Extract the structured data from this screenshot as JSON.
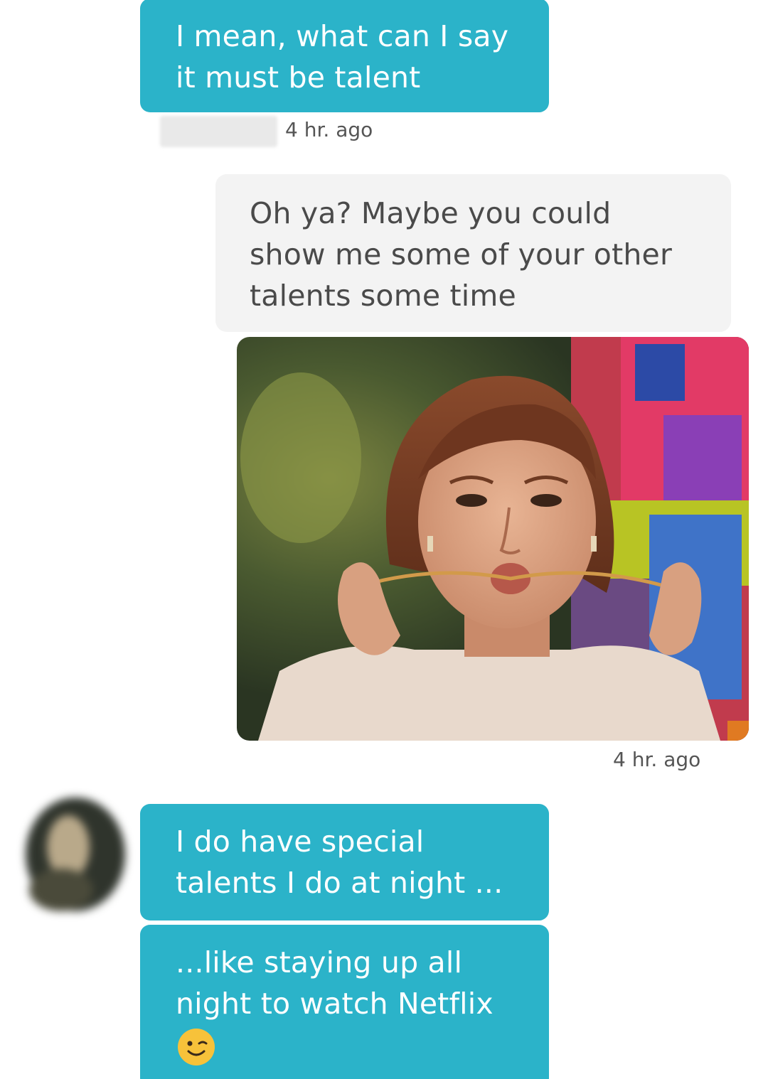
{
  "colors": {
    "incoming_bubble": "#2bb3c9",
    "outgoing_bubble": "#f3f3f3",
    "outgoing_text": "#4a4a4a",
    "timestamp_text": "#555555"
  },
  "messages": [
    {
      "direction": "incoming",
      "text": "I mean, what can I say\nit must be talent"
    },
    {
      "direction": "outgoing",
      "text": "Oh ya? Maybe you could\nshow me some of your other\ntalents some time"
    },
    {
      "direction": "incoming",
      "text": "I do have special\ntalents I do at night ..."
    },
    {
      "direction": "incoming",
      "text": "...like staying up all\nnight to watch Netflix",
      "emoji": "winking-face-icon"
    }
  ],
  "timestamps": {
    "first": "4 hr. ago",
    "second": "4 hr. ago"
  },
  "gif": {
    "icon": "gif-image-woman"
  }
}
